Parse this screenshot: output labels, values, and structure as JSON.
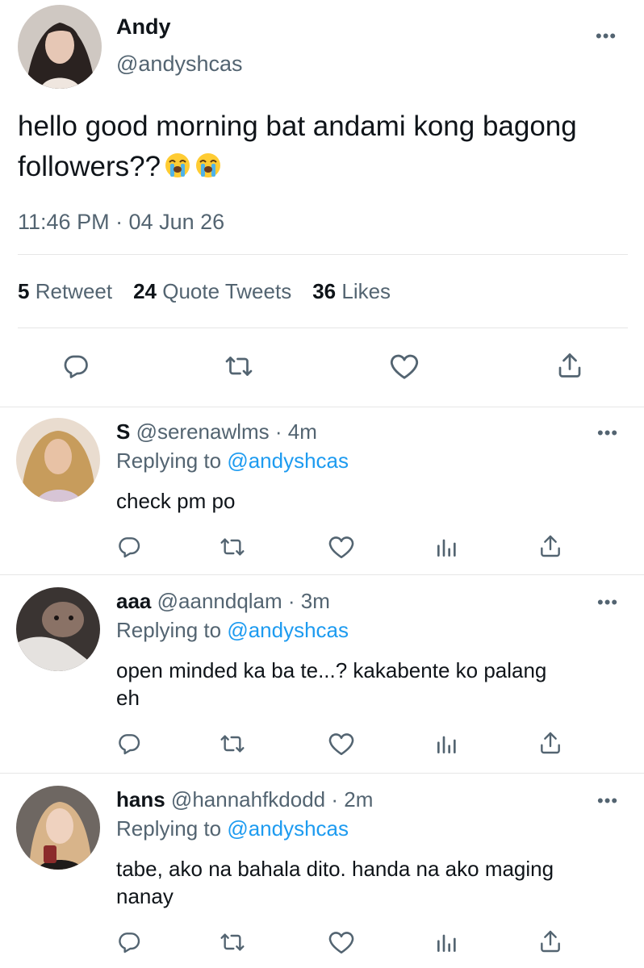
{
  "main_tweet": {
    "author_name": "Andy",
    "handle": "@andyshcas",
    "text_line1": "hello good morning bat andami kong bagong",
    "text_line2": "followers??",
    "emojis": [
      "loudly-crying-face",
      "loudly-crying-face"
    ],
    "timestamp": "11:46 PM · 04 Jun 26",
    "stats": {
      "retweets_count": "5",
      "retweets_label": "Retweet",
      "quotes_count": "24",
      "quotes_label": "Quote Tweets",
      "likes_count": "36",
      "likes_label": "Likes"
    },
    "more_glyph": "•••"
  },
  "replies": [
    {
      "name": "S",
      "handle": "@serenawlms",
      "time": "· 4m",
      "replying_prefix": "Replying to",
      "replying_handle": "@andyshcas",
      "text": [
        "check pm po"
      ]
    },
    {
      "name": "aaa",
      "handle": "@aanndqlam",
      "time": "· 3m",
      "replying_prefix": "Replying to",
      "replying_handle": "@andyshcas",
      "text": [
        "open minded ka ba te...? kakabente ko palang",
        "eh"
      ]
    },
    {
      "name": "hans",
      "handle": "@hannahfkdodd",
      "time": "· 2m",
      "replying_prefix": "Replying to",
      "replying_handle": "@andyshcas",
      "text": [
        "tabe, ako na bahala dito. handa na ako maging",
        "nanay"
      ]
    }
  ],
  "colors": {
    "link": "#1d9bf0",
    "icon": "#536471",
    "divider": "#e6e6e6"
  }
}
